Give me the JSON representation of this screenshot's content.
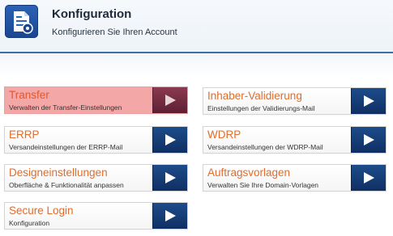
{
  "header": {
    "title": "Konfiguration",
    "subtitle": "Konfigurieren Sie Ihren Account",
    "icon": "settings-document-icon"
  },
  "cards": [
    {
      "label": "Transfer",
      "description": "Verwalten der Transfer-Einstellungen",
      "active": true
    },
    {
      "label": "Inhaber-Validierung",
      "description": "Einstellungen der Validierungs-Mail",
      "active": false
    },
    {
      "label": "ERRP",
      "description": "Versandeinstellungen der ERRP-Mail",
      "active": false
    },
    {
      "label": "WDRP",
      "description": "Versandeinstellungen der WDRP-Mail",
      "active": false
    },
    {
      "label": "Designeinstellungen",
      "description": "Oberfläche & Funktionalität anpassen",
      "active": false
    },
    {
      "label": "Auftragsvorlagen",
      "description": "Verwalten Sie Ihre Domain-Vorlagen",
      "active": false
    },
    {
      "label": "Secure Login",
      "description": "Konfiguration",
      "active": false
    }
  ],
  "colors": {
    "label": "#e06d2b",
    "button": "#163d78",
    "highlight": "#f4a7a7",
    "divider": "#3d6ea3"
  }
}
